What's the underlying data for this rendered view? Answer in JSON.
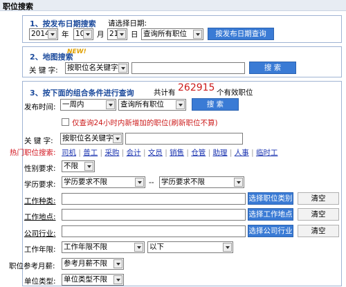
{
  "header": {
    "title": "职位搜索"
  },
  "section1": {
    "title": "1、按发布日期搜索",
    "hint": "请选择日期:",
    "year": "2014",
    "year_unit": "年",
    "month": "10",
    "month_unit": "月",
    "day": "21",
    "day_unit": "日",
    "scope": "查询所有职位",
    "button": "按发布日期查询"
  },
  "section2": {
    "title": "2、地图搜索",
    "new_badge": "NEW!",
    "keyword_label": "关 键 字:",
    "keyword_mode": "按职位名关键字",
    "button": "搜  索"
  },
  "section3": {
    "title": "3、按下面的组合条件进行查询",
    "count_prefix": "共计有",
    "count": "262915",
    "count_suffix": "个有效职位",
    "time_label": "发布时间:",
    "time_value": "一周内",
    "scope_value": "查询所有职位",
    "search_button": "搜  索",
    "only24_label": "仅查询24小时内新增加的职位(刷新职位不算)",
    "keyword_label": "关 键 字:",
    "keyword_mode": "按职位名关键字",
    "hot_label": "热门职位搜索:",
    "hot_items": [
      "司机",
      "普工",
      "采购",
      "会计",
      "文员",
      "销售",
      "仓管",
      "助理",
      "人事",
      "临时工"
    ],
    "gender_label": "性别要求:",
    "gender_value": "不限",
    "edu_label": "学历要求:",
    "edu_from": "学历要求不限",
    "edu_sep": "--",
    "edu_to": "学历要求不限",
    "jobtype_label": "工作种类:",
    "jobtype_button": "选择职位类别",
    "clear1": "清空",
    "location_label": "工作地点:",
    "location_button": "选择工作地点",
    "clear2": "清空",
    "industry_label": "公司行业:",
    "industry_button": "选择公司行业",
    "clear3": "清空",
    "years_label": "工作年限:",
    "years_value": "工作年限不限",
    "years_range": "以下",
    "salary_label": "职位参考月薪:",
    "salary_value": "参考月薪不限",
    "unit_label": "单位类型:",
    "unit_value": "单位类型不限"
  },
  "colors": {
    "accent": "#3a7bd5",
    "title_blue": "#1b4a9c",
    "count_red": "#cc1a1a",
    "hot_red": "#d2141e",
    "note_red": "#cc1a1a"
  }
}
